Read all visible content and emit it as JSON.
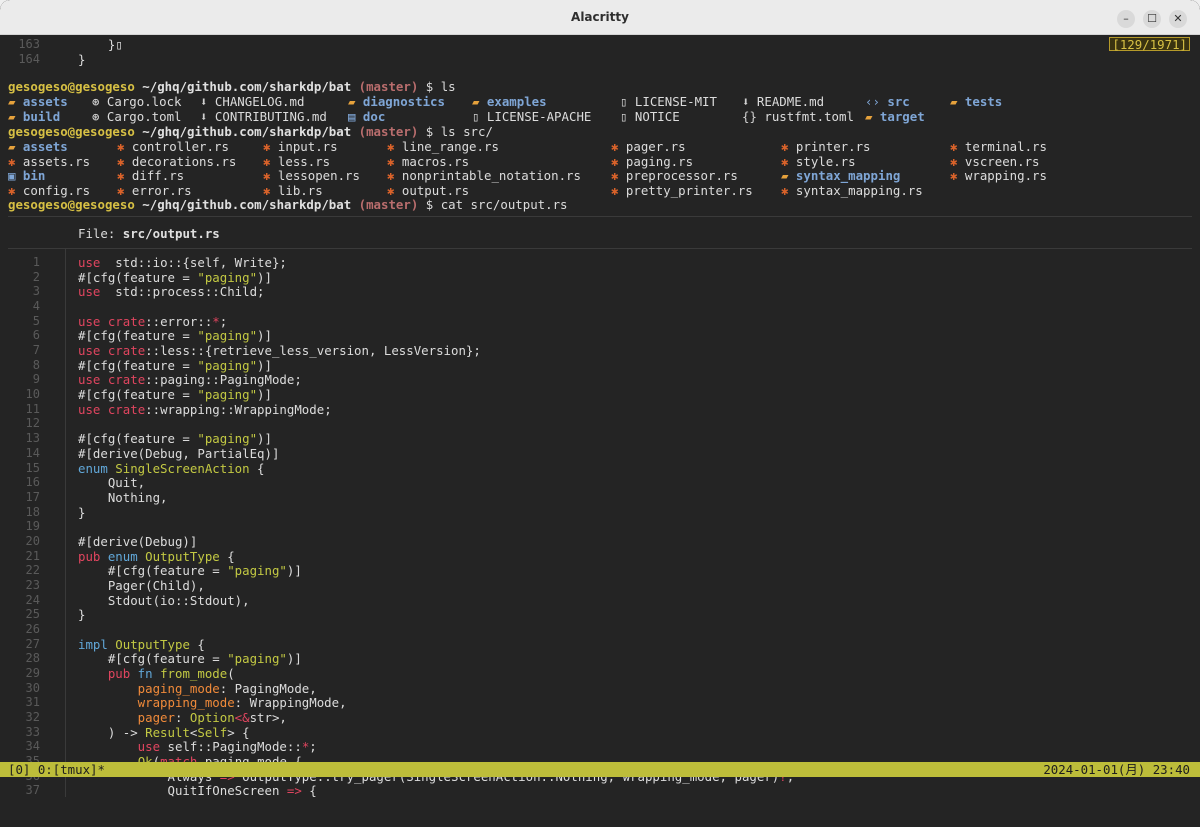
{
  "window": {
    "title": "Alacritty",
    "minimize": "–",
    "maximize": "☐",
    "close": "✕"
  },
  "top": {
    "lines": [
      {
        "n": "163",
        "code": "    }"
      },
      {
        "n": "164",
        "code": "}"
      }
    ],
    "badge": "[129/1971]"
  },
  "prompt": {
    "user": "gesogeso@gesogeso",
    "path": "~/ghq/github.com/sharkdp/bat",
    "branch": "(master)",
    "sym": "$"
  },
  "cmd1": "ls",
  "cmd2": "ls src/",
  "cmd3": "cat src/output.rs",
  "ls_rows": [
    [
      {
        "i": "📂",
        "n": "assets",
        "d": true
      },
      {
        "i": "⚙",
        "n": "Cargo.lock"
      },
      {
        "i": "⬇",
        "n": "CHANGELOG.md"
      },
      {
        "i": "📂",
        "n": "diagnostics",
        "d": true
      },
      {
        "i": "📂",
        "n": "examples",
        "d": true
      },
      {
        "i": "📄",
        "n": "LICENSE-MIT"
      },
      {
        "i": "⬇",
        "n": "README.md"
      },
      {
        "i": "</>",
        "n": "src",
        "d": true
      },
      {
        "i": "📂",
        "n": "tests",
        "d": true
      }
    ],
    [
      {
        "i": "📂",
        "n": "build",
        "d": true
      },
      {
        "i": "⚙",
        "n": "Cargo.toml"
      },
      {
        "i": "⬇",
        "n": "CONTRIBUTING.md"
      },
      {
        "i": "📘",
        "n": "doc",
        "d": true
      },
      {
        "i": "📄",
        "n": "LICENSE-APACHE"
      },
      {
        "i": "📄",
        "n": "NOTICE"
      },
      {
        "i": "{}",
        "n": "rustfmt.toml"
      },
      {
        "i": "📂",
        "n": "target",
        "d": true
      }
    ]
  ],
  "src_rows": [
    [
      {
        "i": "📂",
        "n": "assets",
        "d": true
      },
      {
        "i": "🦀",
        "n": "controller.rs"
      },
      {
        "i": "🦀",
        "n": "input.rs"
      },
      {
        "i": "🦀",
        "n": "line_range.rs"
      },
      {
        "i": "🦀",
        "n": "pager.rs"
      },
      {
        "i": "🦀",
        "n": "printer.rs"
      },
      {
        "i": "🦀",
        "n": "terminal.rs"
      }
    ],
    [
      {
        "i": "🦀",
        "n": "assets.rs"
      },
      {
        "i": "🦀",
        "n": "decorations.rs"
      },
      {
        "i": "🦀",
        "n": "less.rs"
      },
      {
        "i": "🦀",
        "n": "macros.rs"
      },
      {
        "i": "🦀",
        "n": "paging.rs"
      },
      {
        "i": "🦀",
        "n": "style.rs"
      },
      {
        "i": "🦀",
        "n": "vscreen.rs"
      }
    ],
    [
      {
        "i": "📁",
        "n": "bin",
        "d": true
      },
      {
        "i": "🦀",
        "n": "diff.rs"
      },
      {
        "i": "🦀",
        "n": "lessopen.rs"
      },
      {
        "i": "🦀",
        "n": "nonprintable_notation.rs"
      },
      {
        "i": "🦀",
        "n": "preprocessor.rs"
      },
      {
        "i": "📂",
        "n": "syntax_mapping",
        "d": true
      },
      {
        "i": "🦀",
        "n": "wrapping.rs"
      }
    ],
    [
      {
        "i": "🦀",
        "n": "config.rs"
      },
      {
        "i": "🦀",
        "n": "error.rs"
      },
      {
        "i": "🦀",
        "n": "lib.rs"
      },
      {
        "i": "🦀",
        "n": "output.rs"
      },
      {
        "i": "🦀",
        "n": "pretty_printer.rs"
      },
      {
        "i": "🦀",
        "n": "syntax_mapping.rs"
      }
    ]
  ],
  "file_header": {
    "label": "File: ",
    "name": "src/output.rs"
  },
  "code": [
    [
      [
        "kw",
        "use"
      ],
      [
        "",
        "  std::io::{self, Write};"
      ]
    ],
    [
      [
        "",
        "#[cfg(feature = "
      ],
      [
        "str",
        "\"paging\""
      ],
      [
        "",
        ")]"
      ]
    ],
    [
      [
        "kw",
        "use"
      ],
      [
        "",
        "  std::process::Child;"
      ]
    ],
    [],
    [
      [
        "kw",
        "use"
      ],
      [
        "",
        ""
      ],
      [
        "kw",
        " crate"
      ],
      [
        "",
        "::error::"
      ],
      [
        "op",
        "*"
      ],
      [
        "",
        ";"
      ]
    ],
    [
      [
        "",
        "#[cfg(feature = "
      ],
      [
        "str",
        "\"paging\""
      ],
      [
        "",
        ")]"
      ]
    ],
    [
      [
        "kw",
        "use"
      ],
      [
        "kw",
        " crate"
      ],
      [
        "",
        "::less::{retrieve_less_version, LessVersion};"
      ]
    ],
    [
      [
        "",
        "#[cfg(feature = "
      ],
      [
        "str",
        "\"paging\""
      ],
      [
        "",
        ")]"
      ]
    ],
    [
      [
        "kw",
        "use"
      ],
      [
        "kw",
        " crate"
      ],
      [
        "",
        "::paging::PagingMode;"
      ]
    ],
    [
      [
        "",
        "#[cfg(feature = "
      ],
      [
        "str",
        "\"paging\""
      ],
      [
        "",
        ")]"
      ]
    ],
    [
      [
        "kw",
        "use"
      ],
      [
        "kw",
        " crate"
      ],
      [
        "",
        "::wrapping::WrappingMode;"
      ]
    ],
    [],
    [
      [
        "",
        "#[cfg(feature = "
      ],
      [
        "str",
        "\"paging\""
      ],
      [
        "",
        ")]"
      ]
    ],
    [
      [
        "",
        "#[derive(Debug, PartialEq)]"
      ]
    ],
    [
      [
        "kw2",
        "enum"
      ],
      [
        "ty",
        " SingleScreenAction"
      ],
      [
        "",
        " {"
      ]
    ],
    [
      [
        "",
        "    Quit,"
      ]
    ],
    [
      [
        "",
        "    Nothing,"
      ]
    ],
    [
      [
        "",
        "}"
      ]
    ],
    [],
    [
      [
        "",
        "#[derive(Debug)]"
      ]
    ],
    [
      [
        "kw",
        "pub"
      ],
      [
        "kw2",
        " enum"
      ],
      [
        "ty",
        " OutputType"
      ],
      [
        "",
        " {"
      ]
    ],
    [
      [
        "",
        "    #[cfg(feature = "
      ],
      [
        "str",
        "\"paging\""
      ],
      [
        "",
        ")]"
      ]
    ],
    [
      [
        "",
        "    Pager(Child),"
      ]
    ],
    [
      [
        "",
        "    Stdout(io::Stdout),"
      ]
    ],
    [
      [
        "",
        "}"
      ]
    ],
    [],
    [
      [
        "kw2",
        "impl"
      ],
      [
        "ty",
        " OutputType"
      ],
      [
        "",
        " {"
      ]
    ],
    [
      [
        "",
        "    #[cfg(feature = "
      ],
      [
        "str",
        "\"paging\""
      ],
      [
        "",
        ")]"
      ]
    ],
    [
      [
        "kw",
        "    pub"
      ],
      [
        "kw2",
        " fn"
      ],
      [
        "fn",
        " from_mode"
      ],
      [
        "",
        "("
      ]
    ],
    [
      [
        "param",
        "        paging_mode"
      ],
      [
        "",
        ": PagingMode,"
      ]
    ],
    [
      [
        "param",
        "        wrapping_mode"
      ],
      [
        "",
        ": WrappingMode,"
      ]
    ],
    [
      [
        "param",
        "        pager"
      ],
      [
        "",
        ": "
      ],
      [
        "ty",
        "Option"
      ],
      [
        "op",
        "<&"
      ],
      [
        "",
        "str>,"
      ]
    ],
    [
      [
        "",
        "    ) -> "
      ],
      [
        "ty",
        "Result"
      ],
      [
        "",
        "<"
      ],
      [
        "ty",
        "Self"
      ],
      [
        "",
        "> {"
      ]
    ],
    [
      [
        "kw",
        "        use"
      ],
      [
        "",
        " self::PagingMode::"
      ],
      [
        "op",
        "*"
      ],
      [
        "",
        ";"
      ]
    ],
    [
      [
        "",
        "        "
      ],
      [
        "fn",
        "Ok"
      ],
      [
        "",
        "("
      ],
      [
        "kw",
        "match"
      ],
      [
        "",
        " paging_mode {"
      ]
    ],
    [
      [
        "",
        "            Always "
      ],
      [
        "op",
        "=>"
      ],
      [
        "",
        " OutputType::try_pager(SingleScreenAction::Nothing, wrapping_mode, pager)"
      ],
      [
        "op",
        "?"
      ],
      [
        "",
        ","
      ]
    ],
    [
      [
        "",
        "            QuitIfOneScreen "
      ],
      [
        "op",
        "=>"
      ],
      [
        "",
        " {"
      ]
    ]
  ],
  "status": {
    "left": "[0] 0:[tmux]*",
    "right": "2024-01-01(月) 23:40"
  }
}
